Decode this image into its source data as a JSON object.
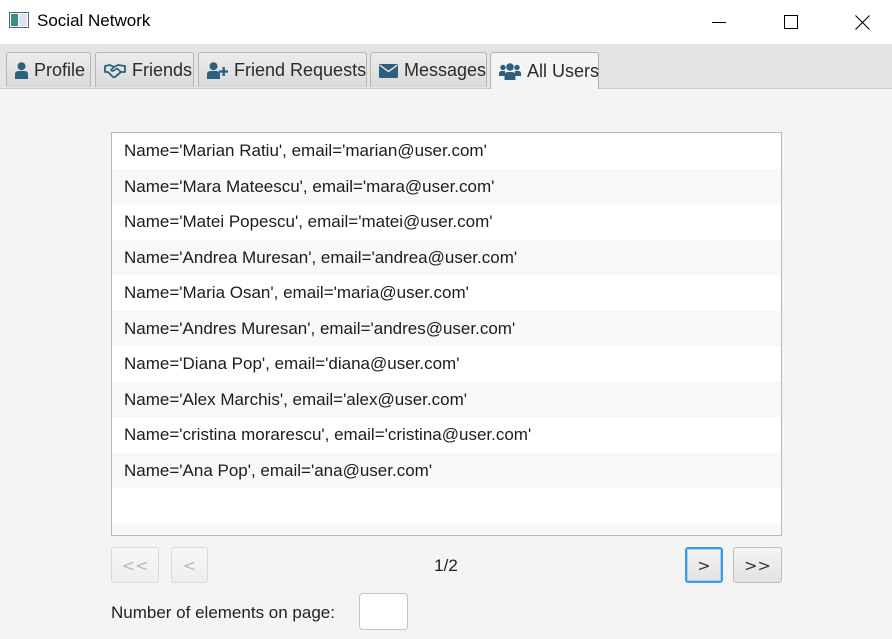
{
  "window": {
    "title": "Social Network"
  },
  "tabs": [
    {
      "label": "Profile",
      "icon": "user-icon"
    },
    {
      "label": "Friends",
      "icon": "handshake-icon"
    },
    {
      "label": "Friend Requests",
      "icon": "user-plus-icon"
    },
    {
      "label": "Messages",
      "icon": "envelope-icon"
    },
    {
      "label": "All Users",
      "icon": "users-icon",
      "active": true
    }
  ],
  "users": [
    "Name='Marian Ratiu', email='marian@user.com'",
    "Name='Mara Mateescu', email='mara@user.com'",
    "Name='Matei Popescu', email='matei@user.com'",
    "Name='Andrea Muresan', email='andrea@user.com'",
    "Name='Maria Osan', email='maria@user.com'",
    "Name='Andres Muresan', email='andres@user.com'",
    "Name='Diana Pop', email='diana@user.com'",
    "Name='Alex Marchis', email='alex@user.com'",
    "Name='cristina morarescu', email='cristina@user.com'",
    "Name='Ana Pop', email='ana@user.com'"
  ],
  "pagination": {
    "first_label": "<<",
    "prev_label": "<",
    "page_text": "1/2",
    "next_label": ">",
    "last_label": ">>"
  },
  "per_page": {
    "label": "Number of elements on page:",
    "value": ""
  },
  "colors": {
    "accent": "#3c9ae0",
    "tab_icon": "#2e5f7e"
  }
}
